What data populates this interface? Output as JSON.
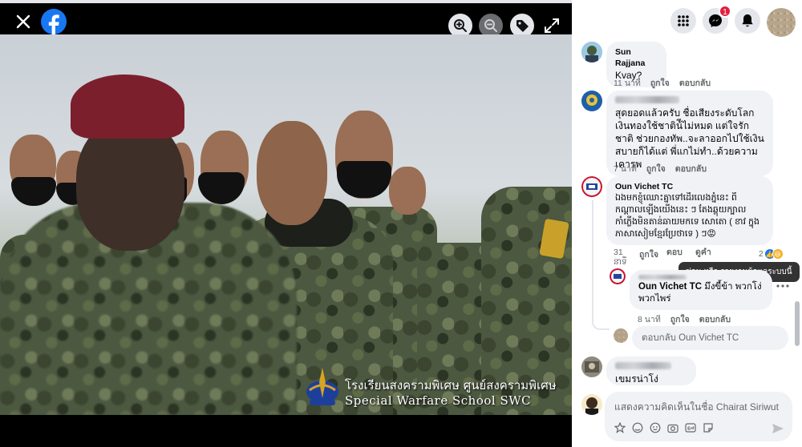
{
  "colors": {
    "fb_blue": "#1877f2",
    "badge_red": "#e41e3f",
    "beret": "#7c1f2c"
  },
  "viewer": {
    "caption_thai": "โรงเรียนสงครามพิเศษ ศูนย์สงครามพิเศษ",
    "caption_en": "Special Warfare School SWC",
    "icons": [
      "close-icon",
      "facebook-logo",
      "zoom-in-icon",
      "zoom-out-icon",
      "tag-icon",
      "expand-icon"
    ]
  },
  "header": {
    "messenger_badge": "1"
  },
  "comments": [
    {
      "name": "Sun Rajjana",
      "text": "Kvay?",
      "time": "11 นาที",
      "like": "ถูกใจ",
      "reply": "ตอบกลับ"
    },
    {
      "name": "",
      "text": "สุดยอดแล้วครับ ชื่อเสียงระดับโลก เงินทองใช้ชาติน้ีไม่หมด แต่ใจรักชาติ ช่วยกองทัพ..จะลาออกไปใช้เงินสบายก็ได้แต่ พี่แกไม่ทำ..ด้วยความเคารพ",
      "time": "7 นาที",
      "like": "ถูกใจ",
      "reply": "ตอบกลับ"
    },
    {
      "name": "Oun Vichet TC",
      "text": "ឯងមកខ្ញុំឈោះគ្នាទៅដើរលេងភ្នំនេះ ពីកណ្ដាលឡើងយើងនេះ ៗ តែងឆ្ពុយក្បាលកាំភ្លើងមិនតាន់ឆាយមកទេ សោតោ ( ខាវ ក្នុងភាសាសៀមខ្មែរប្រែថាទេ ) ៗ😡",
      "time": "31 នាទី",
      "like": "ถูกใจ",
      "reply": "ตอบกลับ",
      "more": "ดูคำแปล",
      "reaction_count": "2"
    },
    {
      "name": "Oun Vichet TC",
      "text": "มึงขี้ข้า พวกโง่ พวกไพร่",
      "time": "8 นาที",
      "like": "ถูกใจ",
      "reply": "ตอบกลับ"
    },
    {
      "name": "",
      "text": "เขมรน่าโง่",
      "time": "",
      "like": "",
      "reply": ""
    }
  ],
  "tooltip": "ซ่อน หรือ รายงานผู้ดูแลระบบนี้",
  "reply_box": {
    "placeholder": "ตอบกลับ Oun Vichet TC"
  },
  "composer": {
    "placeholder": "แสดงความคิดเห็นในชื่อ Chairat Siriwut"
  }
}
